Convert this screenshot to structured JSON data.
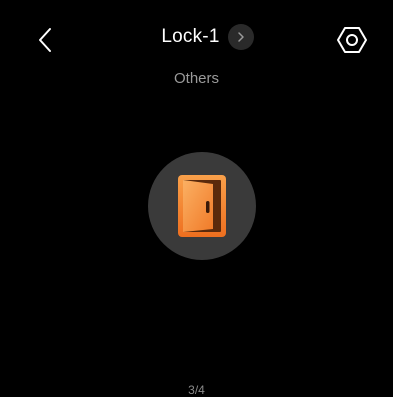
{
  "header": {
    "title": "Lock-1",
    "back_icon": "chevron-left-icon",
    "title_chevron_icon": "chevron-right-icon",
    "settings_icon": "hexagon-settings-icon"
  },
  "room": {
    "label": "Others"
  },
  "device": {
    "icon": "door-icon",
    "accent_color": "#f5822a",
    "circle_color": "#3a3a3a"
  },
  "pager": {
    "text": "3/4"
  }
}
